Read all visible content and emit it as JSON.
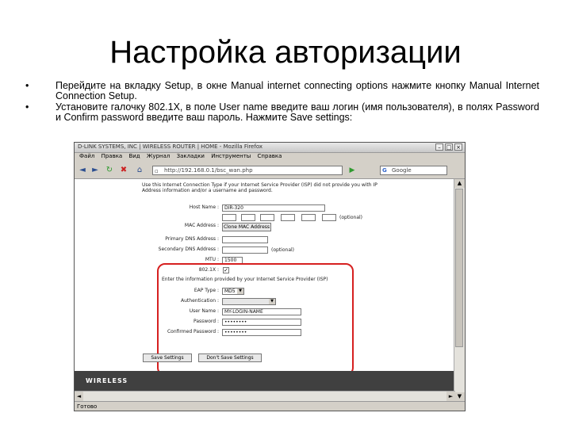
{
  "slide": {
    "title": "Настройка авторизации",
    "bullets": [
      "Перейдите на вкладку Setup, в окне Manual internet connecting options нажмите кнопку Manual Internet Connection Setup.",
      " Установите галочку 802.1X, в поле User name введите ваш логин (имя пользователя), в полях Password и Confirm password введите ваш пароль. Нажмите Save settings:"
    ],
    "bullet_glyph": "•"
  },
  "browser": {
    "window_title": "D-LINK SYSTEMS, INC | WIRELESS ROUTER | HOME - Mozilla Firefox",
    "menu": [
      "Файл",
      "Правка",
      "Вид",
      "Журнал",
      "Закладки",
      "Инструменты",
      "Справка"
    ],
    "url": "http://192.168.0.1/bsc_wan.php",
    "search_placeholder": "Google",
    "status": "Готово",
    "icons": {
      "back": "back-arrow-icon",
      "forward": "forward-arrow-icon",
      "reload": "reload-icon",
      "stop": "stop-icon",
      "home": "home-icon",
      "go": "go-arrow-icon",
      "search": "google-search-icon"
    }
  },
  "form": {
    "intro": "Use this Internet Connection Type if your Internet Service Provider (ISP) did not provide you with IP Address information and/or a username and password.",
    "labels": {
      "host_name": "Host Name :",
      "mac_address": "MAC Address :",
      "primary_dns": "Primary DNS Address :",
      "secondary_dns": "Secondary DNS Address :",
      "mtu": "MTU :",
      "x8021": "802.1X :",
      "isp_info": "Enter the information provided by your Internet Service Provider (ISP)",
      "eap_type": "EAP Type :",
      "authentication": "Authentication :",
      "user_name": "User Name :",
      "password": "Password :",
      "confirm_password": "Confirmed Password :"
    },
    "values": {
      "host_name": "DIR-320",
      "mtu": "1500",
      "x8021_checked": "✓",
      "eap_type": "MD5",
      "authentication": "",
      "user_name": "MY-LOGIN-NAME",
      "password": "••••••••",
      "confirm_password": "••••••••"
    },
    "optional": "(optional)",
    "clone_button": "Clone MAC Address",
    "save_button": "Save Settings",
    "dont_save_button": "Don't Save Settings",
    "banner": "WIRELESS"
  },
  "colors": {
    "highlight": "#d62020",
    "banner": "#404040"
  }
}
